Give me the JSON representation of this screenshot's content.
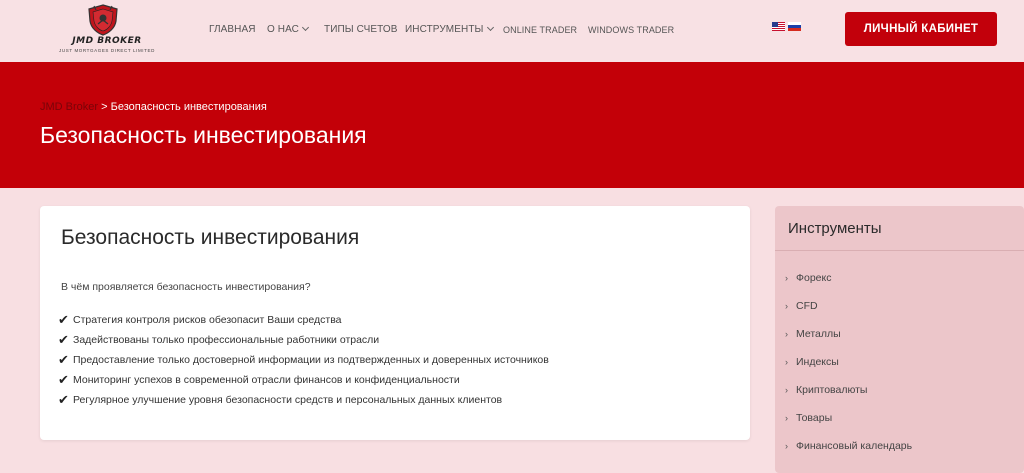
{
  "header": {
    "logo": {
      "name": "JMD BROKER",
      "tagline": "JUST MORTGAGES DIRECT LIMITED"
    },
    "nav": [
      {
        "label": "ГЛАВНАЯ"
      },
      {
        "label": "О НАС"
      },
      {
        "label": "ТИПЫ СЧЕТОВ"
      },
      {
        "label": "ИНСТРУМЕНТЫ"
      },
      {
        "label": "ONLINE TRADER"
      },
      {
        "label": "WINDOWS TRADER"
      }
    ],
    "cabinet_label": "ЛИЧНЫЙ КАБИНЕТ"
  },
  "banner": {
    "breadcrumb_home": "JMD Broker",
    "breadcrumb_sep": " > ",
    "breadcrumb_current": "Безопасность инвестирования",
    "title": "Безопасность инвестирования"
  },
  "main": {
    "title": "Безопасность инвестирования",
    "question": "В чём проявляется безопасность инвестирования?",
    "items": [
      "Стратегия контроля рисков обезопасит Ваши средства",
      "Задействованы только профессиональные работники отрасли",
      "Предоставление только достоверной информации из подтвержденных и доверенных источников",
      "Мониторинг успехов в современной отрасли финансов и конфиденциальности",
      "Регулярное улучшение уровня безопасности средств и персональных данных клиентов"
    ]
  },
  "sidebar": {
    "title": "Инструменты",
    "items": [
      "Форекс",
      "CFD",
      "Металлы",
      "Индексы",
      "Криптовалюты",
      "Товары",
      "Финансовый календарь"
    ]
  },
  "colors": {
    "brand_red": "#c30008",
    "page_bg": "#f8dfe2",
    "sidebar_bg": "#ecc6ca"
  }
}
